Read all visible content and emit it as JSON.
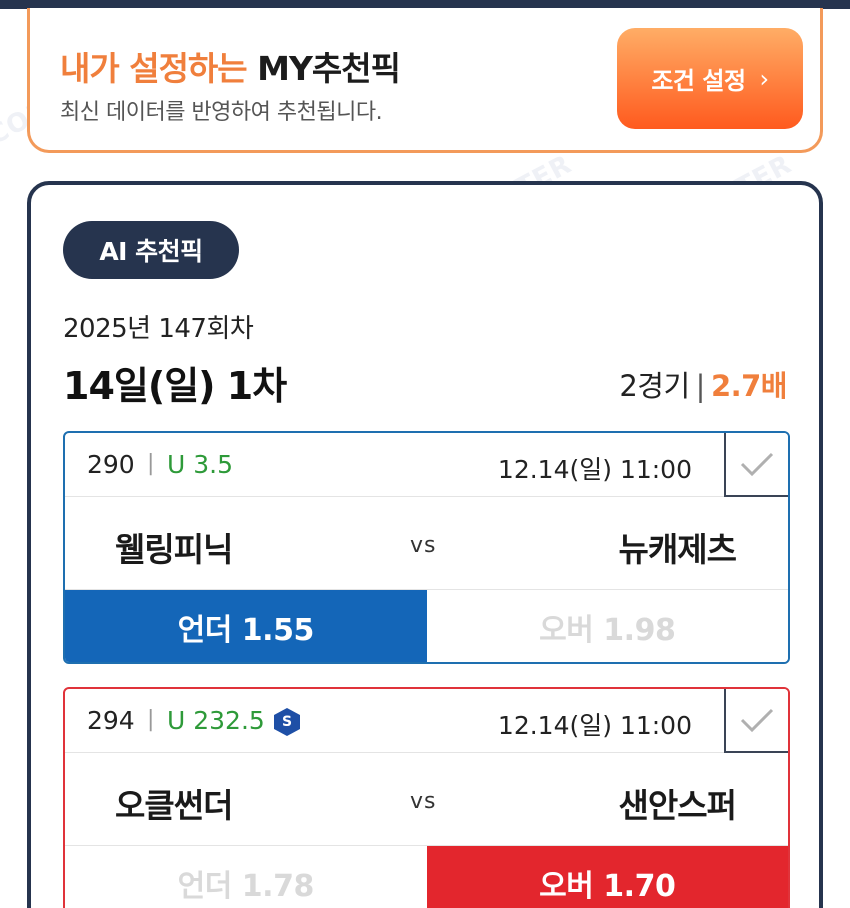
{
  "promo": {
    "title_accent": "내가 설정하는",
    "title_dark": "MY추천픽",
    "subtitle": "최신 데이터를 반영하여 추천됩니다.",
    "button_label": "조건 설정",
    "button_chevron": "›"
  },
  "ai": {
    "badge": "AI 추천픽",
    "round": "2025년 147회차",
    "day": "14일(일) 1차",
    "games": "2경기",
    "sep": "|",
    "multiplier": "2.7배"
  },
  "matches": [
    {
      "number": "290",
      "handicap": "U 3.5",
      "datetime": "12.14(일) 11:00",
      "home": "웰링피닉",
      "vs": "vs",
      "away": "뉴캐제츠",
      "under": "언더 1.55",
      "over": "오버 1.98",
      "selected": "under",
      "accent": "#1466b8"
    },
    {
      "number": "294",
      "handicap": "U 232.5",
      "badge": "S",
      "datetime": "12.14(일) 11:00",
      "home": "오클썬더",
      "vs": "vs",
      "away": "샌안스퍼",
      "under": "언더 1.78",
      "over": "오버 1.70",
      "selected": "over",
      "accent": "#e3262d"
    }
  ],
  "watermark": "SCORECENTER",
  "icons": {
    "check": "check-icon",
    "chevron": "chevron-right-icon",
    "special": "special-badge-icon"
  }
}
